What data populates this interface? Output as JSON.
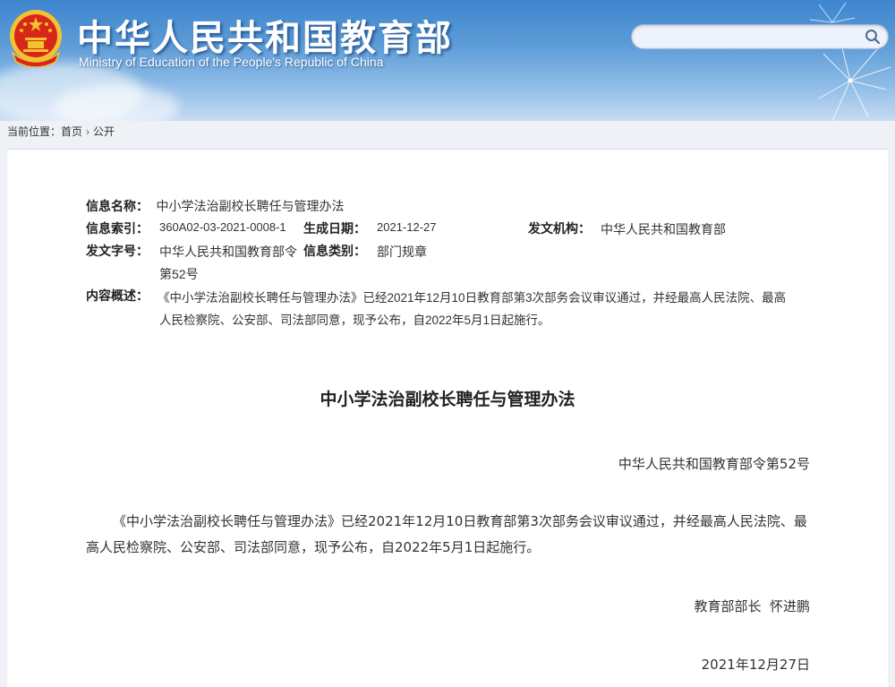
{
  "header": {
    "site_title": "中华人民共和国教育部",
    "site_subtitle": "Ministry of Education of the People's Republic of China",
    "search": {
      "value": "",
      "placeholder": ""
    }
  },
  "breadcrumb": {
    "label": "当前位置：",
    "home": "首页",
    "separator": "›",
    "current": "公开"
  },
  "meta": {
    "name_label": "信息名称：",
    "name_value": "中小学法治副校长聘任与管理办法",
    "index_label": "信息索引：",
    "index_value": "360A02-03-2021-0008-1",
    "date_label": "生成日期：",
    "date_value": "2021-12-27",
    "issuer_label": "发文机构：",
    "issuer_value": "中华人民共和国教育部",
    "docno_label": "发文字号：",
    "docno_value_line1": "中华人民共和国教育部令",
    "docno_value_line2": "第52号",
    "category_label": "信息类别：",
    "category_value": "部门规章",
    "summary_label": "内容概述：",
    "summary_line1": "《中小学法治副校长聘任与管理办法》已经2021年12月10日教育部第3次部务会议审议通过，并经最高人民法院、最高",
    "summary_line2": "人民检察院、公安部、司法部同意，现予公布，自2022年5月1日起施行。"
  },
  "document": {
    "title": "中小学法治副校长聘任与管理办法",
    "order_number": "中华人民共和国教育部令第52号",
    "paragraph": "《中小学法治副校长聘任与管理办法》已经2021年12月10日教育部第3次部务会议审议通过，并经最高人民法院、最高人民检察院、公安部、司法部同意，现予公布，自2022年5月1日起施行。",
    "signer": "教育部部长  怀进鹏",
    "date": "2021年12月27日"
  },
  "colors": {
    "header_blue": "#3f86cf",
    "emblem_red": "#d62718",
    "emblem_gold": "#f3c232"
  },
  "icons": {
    "emblem": "national-emblem-icon",
    "search": "magnifier-icon"
  }
}
